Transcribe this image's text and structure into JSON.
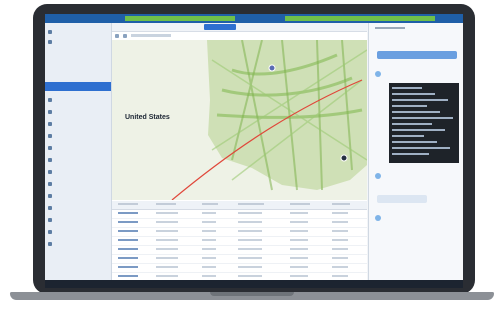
{
  "map": {
    "title": "United States"
  },
  "tabs": [
    "",
    "",
    "",
    ""
  ],
  "sidebar": {
    "items": [
      "",
      "",
      "",
      "",
      "",
      "",
      "",
      "",
      "",
      "",
      "",
      "",
      "",
      "",
      "",
      "",
      "",
      "",
      "",
      ""
    ]
  },
  "colors": {
    "topbar": "#1f5fa8",
    "accent_green": "#6fbf4a",
    "active_blue": "#2e6fd0",
    "flight_path": "#e0473a",
    "map_green": "#7fb24f"
  }
}
